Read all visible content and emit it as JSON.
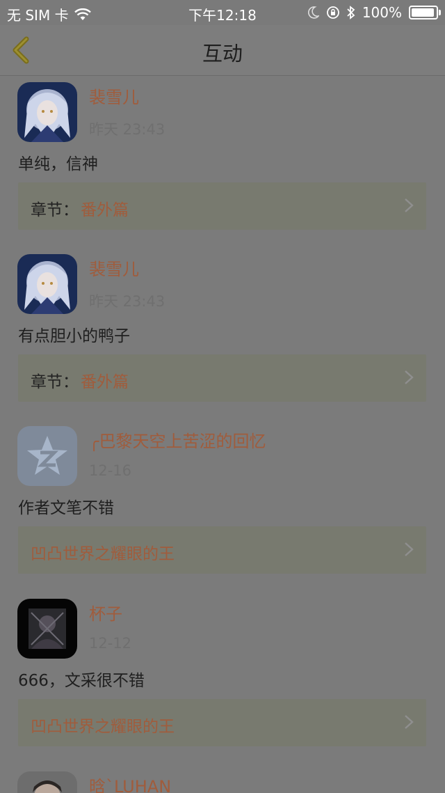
{
  "status_bar": {
    "carrier": "无 SIM 卡",
    "time": "下午12:18",
    "battery": "100%"
  },
  "nav": {
    "title": "互动"
  },
  "items": [
    {
      "username": "裴雪儿",
      "time": "昨天 23:43",
      "content": "单纯，信神",
      "chapter_label": "章节：",
      "chapter_link": "番外篇"
    },
    {
      "username": "裴雪儿",
      "time": "昨天 23:43",
      "content": "有点胆小的鸭子",
      "chapter_label": "章节：",
      "chapter_link": "番外篇"
    },
    {
      "username": "╭巴黎天空上苦涩的回忆",
      "time": "12-16",
      "content": "作者文笔不错",
      "chapter_label": "",
      "chapter_link": "凹凸世界之耀眼的王"
    },
    {
      "username": "杯子",
      "time": "12-12",
      "content": "666，文采很不错",
      "chapter_label": "",
      "chapter_link": "凹凸世界之耀眼的王"
    },
    {
      "username": "晗`LUHAN"
    }
  ]
}
